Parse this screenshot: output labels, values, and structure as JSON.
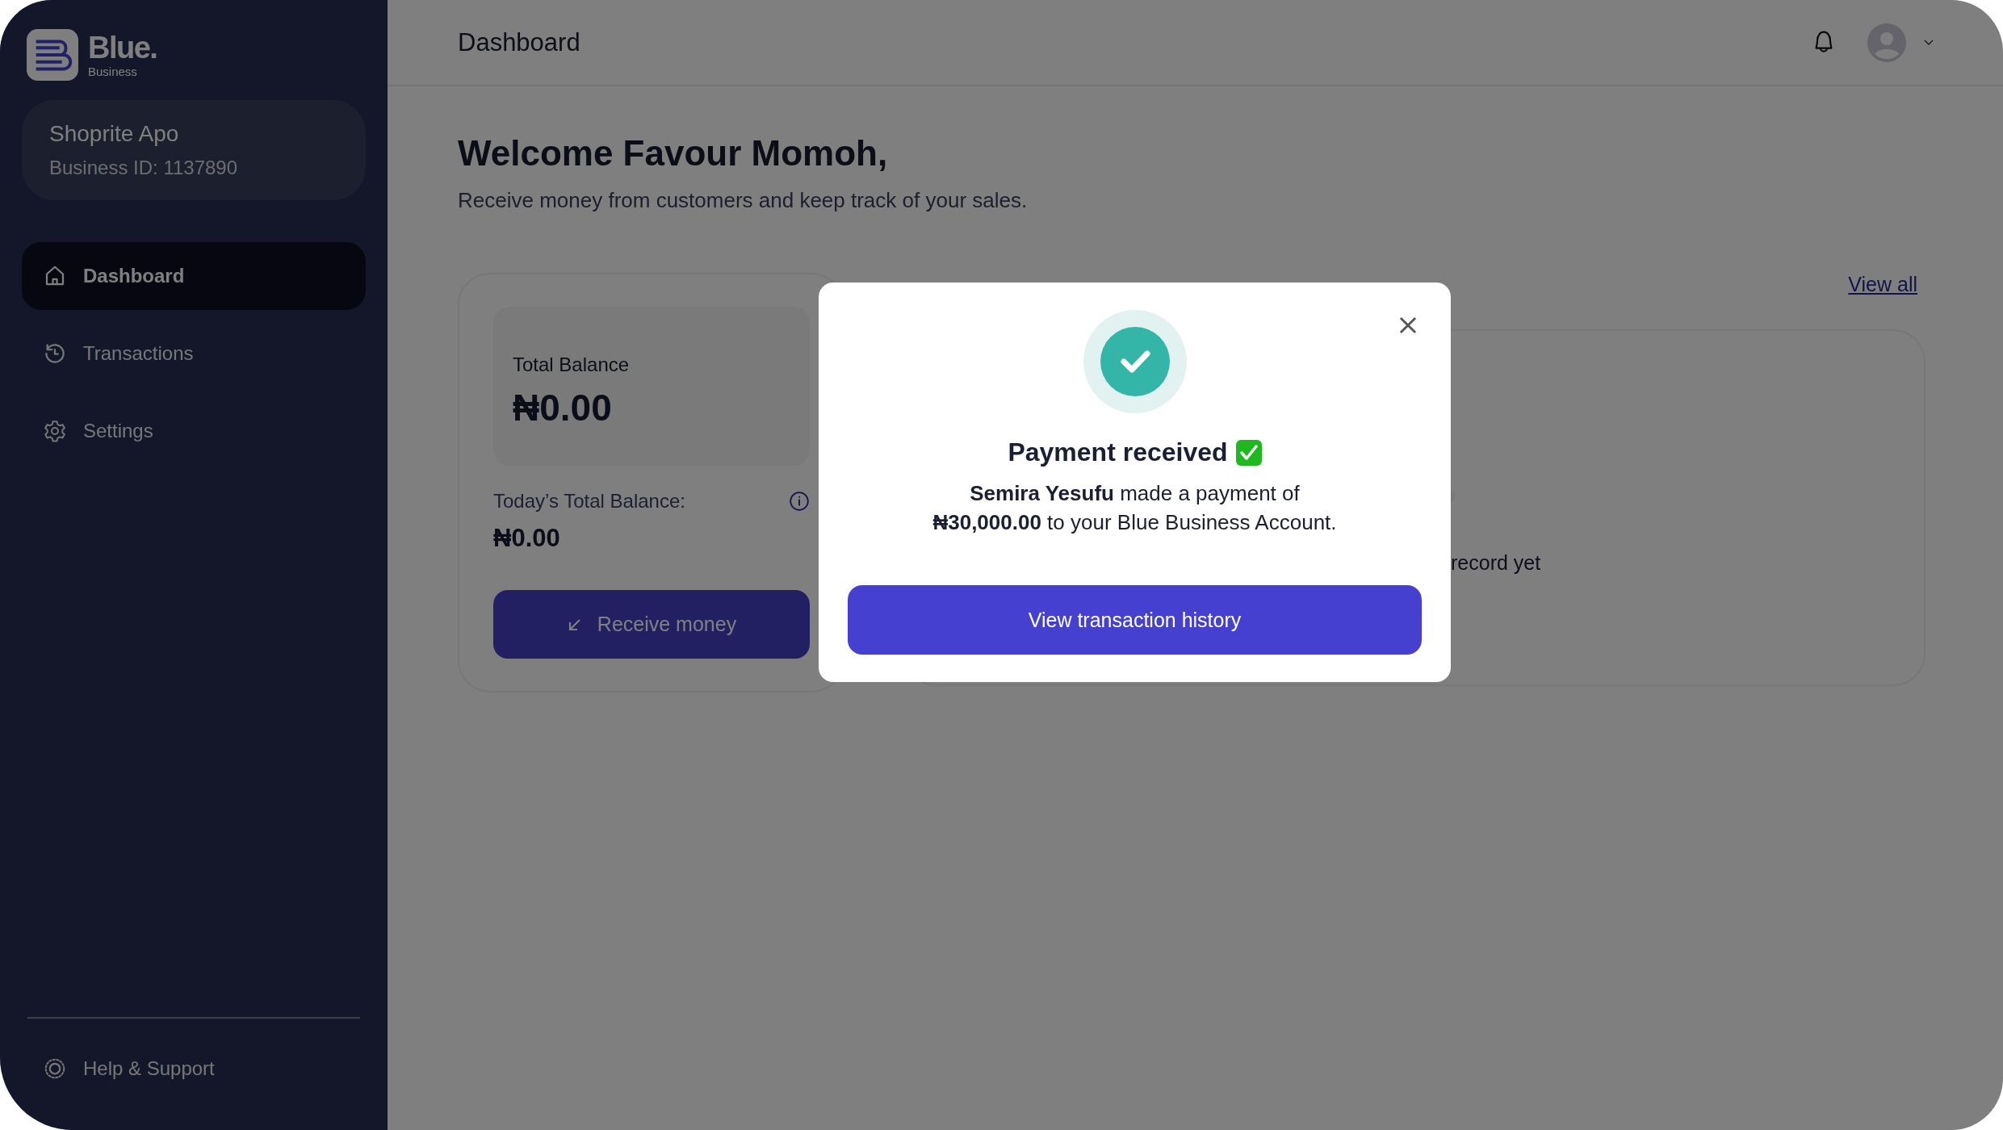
{
  "brand": {
    "name": "Blue.",
    "tagline": "Business"
  },
  "business": {
    "name": "Shoprite Apo",
    "id_label": "Business ID: 1137890"
  },
  "nav": [
    {
      "label": "Dashboard",
      "kind": "home",
      "selected": true
    },
    {
      "label": "Transactions",
      "kind": "history",
      "selected": false
    },
    {
      "label": "Settings",
      "kind": "settings",
      "selected": false
    }
  ],
  "help": {
    "label": "Help & Support"
  },
  "topbar": {
    "title": "Dashboard"
  },
  "welcome": {
    "heading": "Welcome Favour Momoh,",
    "subtitle": "Receive money from customers and keep track of your sales."
  },
  "balance": {
    "label": "Total Balance",
    "amount": "₦0.00",
    "today_label": "Today’s Total Balance:",
    "today_amount": "₦0.00",
    "button": "Receive money"
  },
  "recent": {
    "link": "View all",
    "empty_text": "record yet"
  },
  "modal": {
    "title": "Payment received",
    "message": "**Semira Yesufu** made a payment of\n**₦30,000.00** to your Blue Business Account.",
    "button": "View transaction history"
  }
}
